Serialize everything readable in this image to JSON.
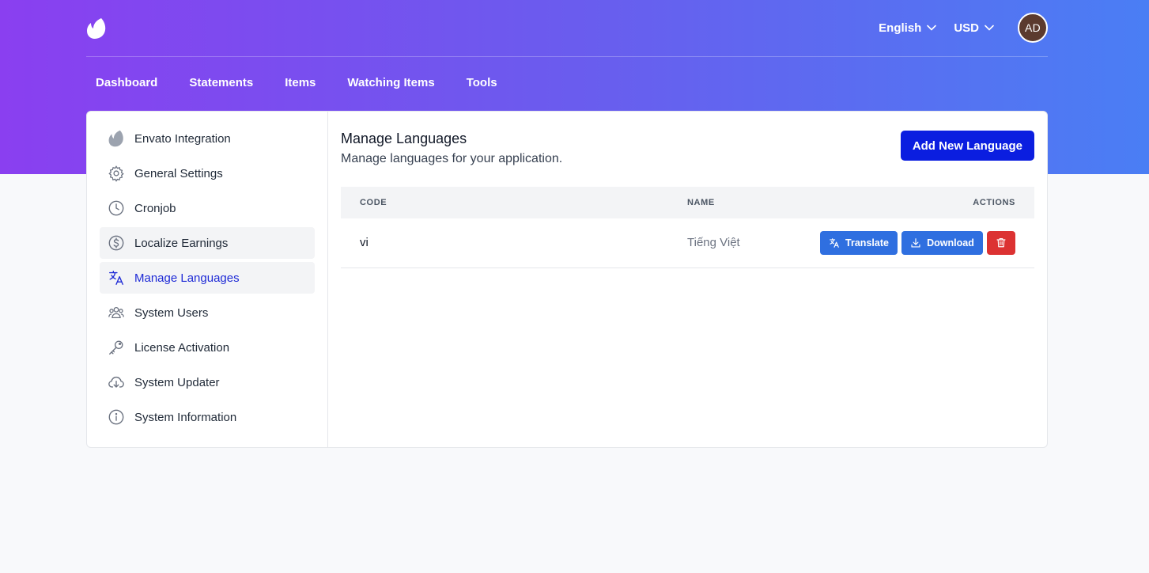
{
  "header": {
    "language_label": "English",
    "currency_label": "USD",
    "avatar_initials": "AD"
  },
  "nav": {
    "items": [
      "Dashboard",
      "Statements",
      "Items",
      "Watching Items",
      "Tools"
    ]
  },
  "sidebar": {
    "items": [
      {
        "label": "Envato Integration",
        "icon": "envato-icon"
      },
      {
        "label": "General Settings",
        "icon": "gear-icon"
      },
      {
        "label": "Cronjob",
        "icon": "clock-icon"
      },
      {
        "label": "Localize Earnings",
        "icon": "dollar-circle-icon"
      },
      {
        "label": "Manage Languages",
        "icon": "translate-icon"
      },
      {
        "label": "System Users",
        "icon": "users-icon"
      },
      {
        "label": "License Activation",
        "icon": "key-icon"
      },
      {
        "label": "System Updater",
        "icon": "cloud-download-icon"
      },
      {
        "label": "System Information",
        "icon": "info-icon"
      }
    ]
  },
  "main": {
    "title": "Manage Languages",
    "subtitle": "Manage languages for your application.",
    "add_button": "Add New Language",
    "table": {
      "headers": {
        "code": "CODE",
        "name": "NAME",
        "actions": "ACTIONS"
      },
      "rows": [
        {
          "code": "vi",
          "name": "Tiếng Việt",
          "translate": "Translate",
          "download": "Download"
        }
      ]
    }
  },
  "colors": {
    "gradient_start": "#8a3ff0",
    "gradient_end": "#4a7ef4",
    "primary_button": "#0b1ee0",
    "action_blue": "#2f6fe0",
    "danger": "#dc3232",
    "active_link": "#1e2ad6"
  }
}
